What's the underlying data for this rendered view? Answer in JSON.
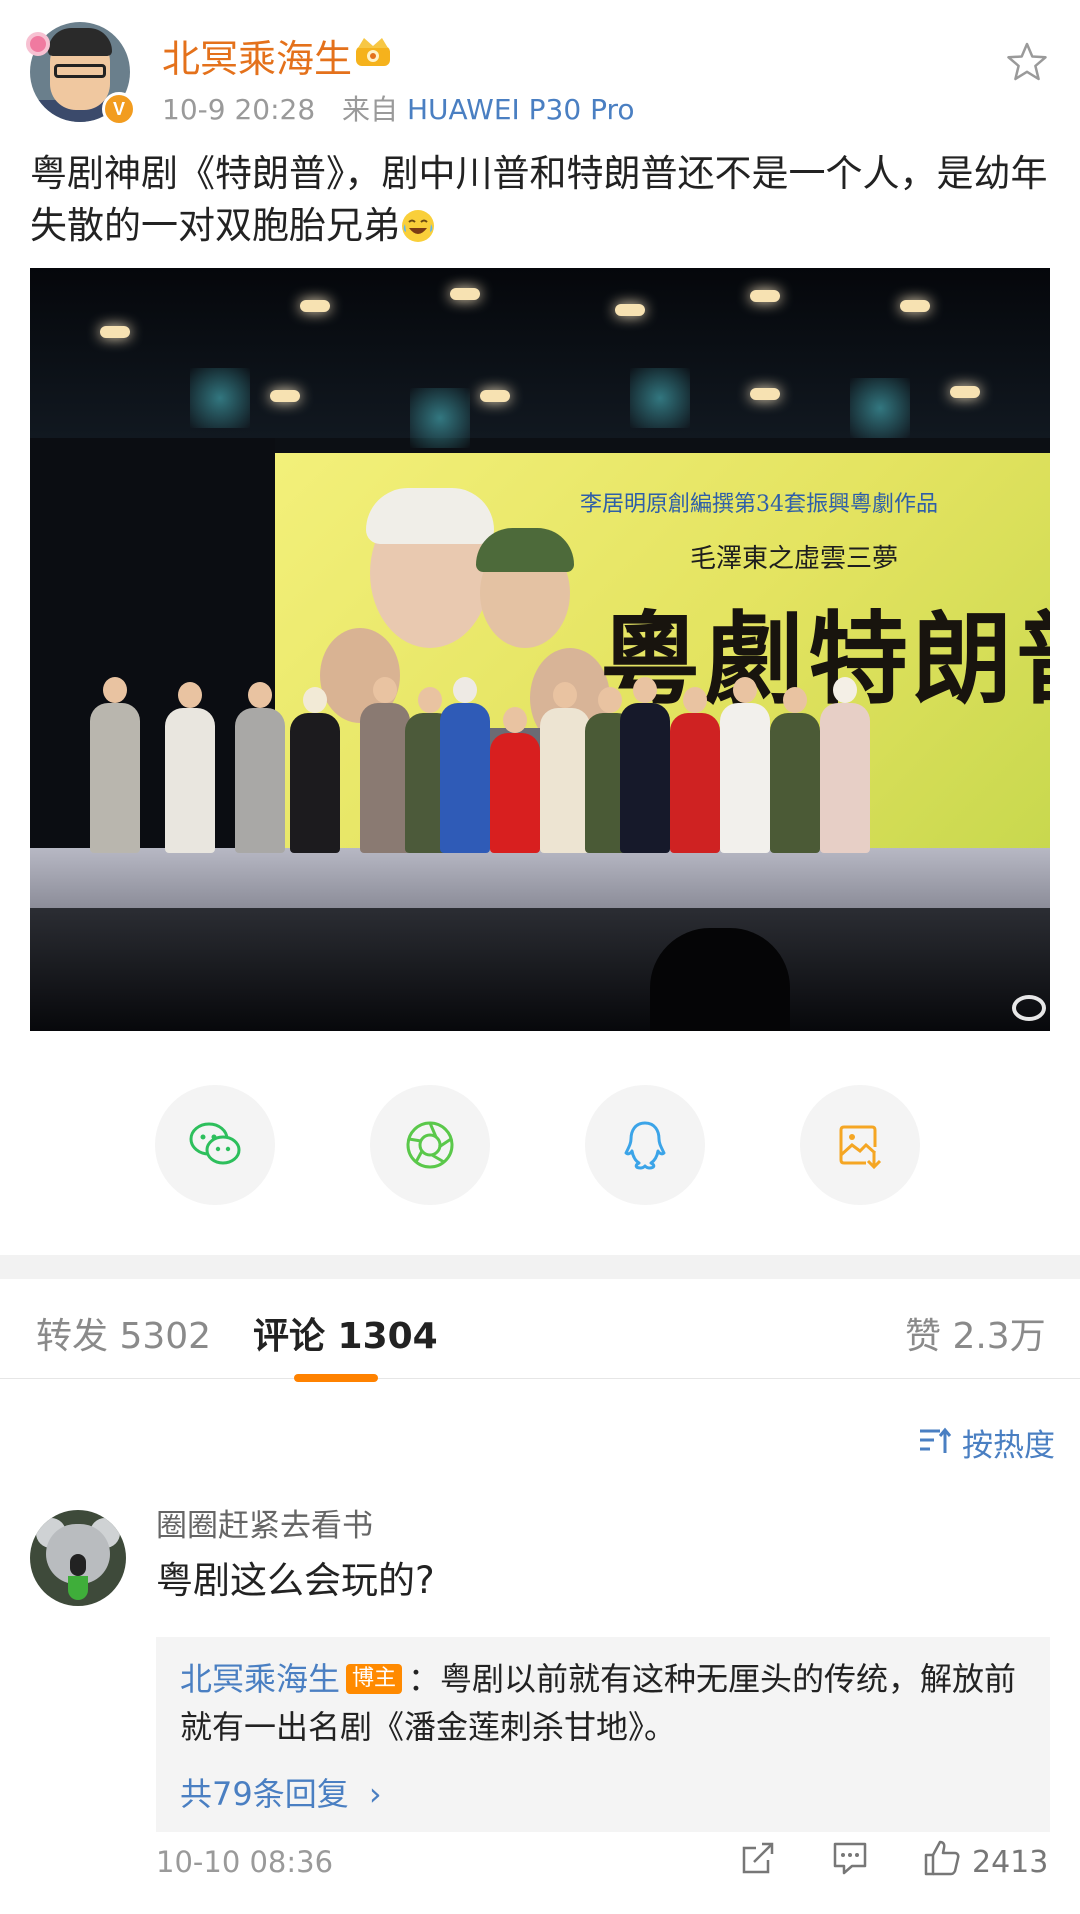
{
  "post": {
    "author": "北冥乘海生",
    "time": "10-9 20:28",
    "source_prefix": "来自",
    "device": "HUAWEI P30 Pro",
    "text": "粤剧神剧《特朗普》，剧中川普和特朗普还不是一个人，是幼年失散的一对双胞胎兄弟"
  },
  "media": {
    "backdrop_caption": "李居明原創編撰第34套振興粵劇作品",
    "backdrop_subtitle": "毛澤東之虛雲三夢",
    "backdrop_title": "粵劇特朗普"
  },
  "share": {
    "icons": [
      "wechat-icon",
      "moments-icon",
      "qq-icon",
      "save-image-icon"
    ],
    "colors": [
      "#2dbf5c",
      "#5ac84a",
      "#3ba4e8",
      "#f5a623"
    ]
  },
  "tabs": {
    "repost": "转发 5302",
    "comments": "评论 1304",
    "likes": "赞 2.3万"
  },
  "sort": {
    "label": "按热度"
  },
  "comment": {
    "author": "圈圈赶紧去看书",
    "text": "粤剧这么会玩的?",
    "reply_author": "北冥乘海生",
    "reply_badge": "博主",
    "reply_text": "：粤剧以前就有这种无厘头的传统，解放前就有一出名剧《潘金莲刺杀甘地》。",
    "reply_more": "共79条回复",
    "time": "10-10 08:36",
    "like_count": "2413"
  },
  "colors": {
    "accent": "#ff8200",
    "link": "#4a7fc2",
    "username": "#e4711b"
  }
}
